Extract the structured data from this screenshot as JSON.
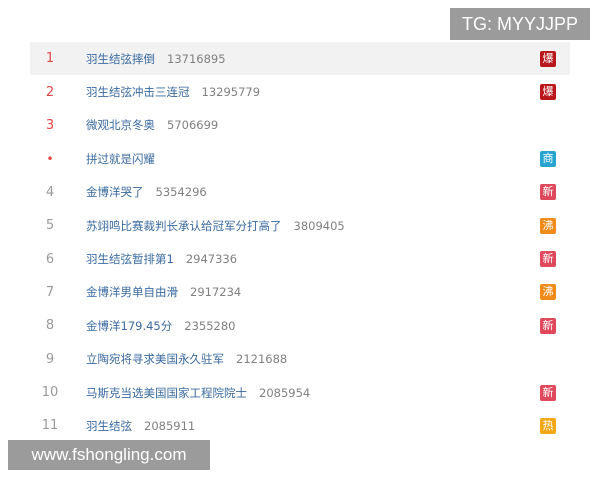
{
  "watermark_top": "TG: MYYJJPP",
  "watermark_bottom": "www.fshongling.com",
  "items": [
    {
      "rank": "1",
      "title": "羽生结弦摔倒",
      "count": "13716895",
      "badge": "爆",
      "badge_color": "#b8181b"
    },
    {
      "rank": "2",
      "title": "羽生结弦冲击三连冠",
      "count": "13295779",
      "badge": "爆",
      "badge_color": "#b8181b"
    },
    {
      "rank": "3",
      "title": "微观北京冬奥",
      "count": "5706699",
      "badge": "",
      "badge_color": ""
    },
    {
      "rank": "•",
      "title": "拼过就是闪耀",
      "count": "",
      "badge": "商",
      "badge_color": "#27a3d0"
    },
    {
      "rank": "4",
      "title": "金博洋哭了",
      "count": "5354296",
      "badge": "新",
      "badge_color": "#e0485c"
    },
    {
      "rank": "5",
      "title": "苏翊鸣比赛裁判长承认给冠军分打高了",
      "count": "3809405",
      "badge": "沸",
      "badge_color": "#f08a18"
    },
    {
      "rank": "6",
      "title": "羽生结弦暂排第1",
      "count": "2947336",
      "badge": "新",
      "badge_color": "#e0485c"
    },
    {
      "rank": "7",
      "title": "金博洋男单自由滑",
      "count": "2917234",
      "badge": "沸",
      "badge_color": "#f08a18"
    },
    {
      "rank": "8",
      "title": "金博洋179.45分",
      "count": "2355280",
      "badge": "新",
      "badge_color": "#e0485c"
    },
    {
      "rank": "9",
      "title": "立陶宛将寻求美国永久驻军",
      "count": "2121688",
      "badge": "",
      "badge_color": ""
    },
    {
      "rank": "10",
      "title": "马斯克当选美国国家工程院院士",
      "count": "2085954",
      "badge": "新",
      "badge_color": "#e0485c"
    },
    {
      "rank": "11",
      "title": "羽生结弦",
      "count": "2085911",
      "badge": "热",
      "badge_color": "#f3a716"
    }
  ]
}
